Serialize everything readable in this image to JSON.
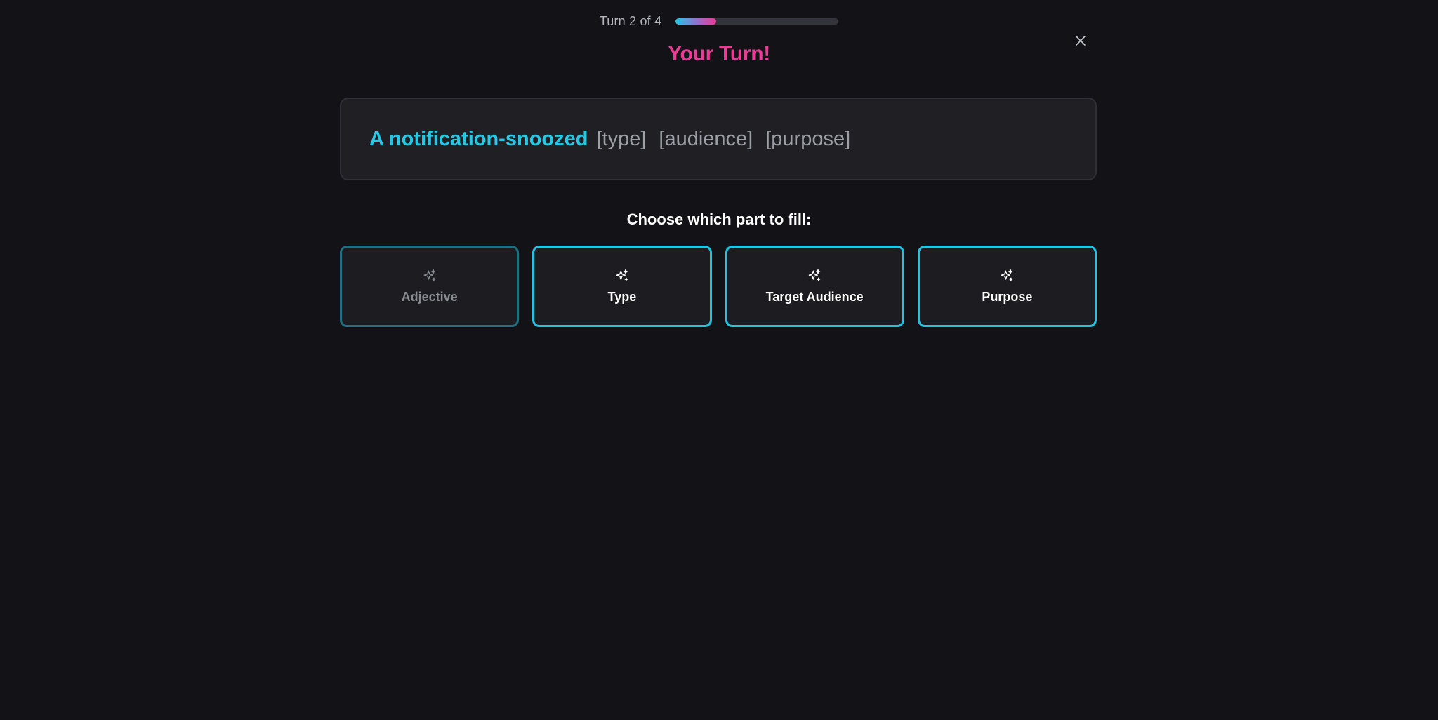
{
  "header": {
    "turn_label": "Turn 2 of 4",
    "progress_fraction": 0.25,
    "close_icon": "close-icon"
  },
  "title": "Your Turn!",
  "sentence": {
    "filled": "A notification-snoozed",
    "blanks": [
      "[type]",
      "[audience]",
      "[purpose]"
    ]
  },
  "prompt": "Choose which part to fill:",
  "options": [
    {
      "label": "Adjective",
      "icon": "sparkles-icon",
      "enabled": false
    },
    {
      "label": "Type",
      "icon": "sparkles-icon",
      "enabled": true
    },
    {
      "label": "Target Audience",
      "icon": "sparkles-icon",
      "enabled": true
    },
    {
      "label": "Purpose",
      "icon": "sparkles-icon",
      "enabled": true
    }
  ],
  "colors": {
    "accent_cyan": "#22c3e3",
    "accent_pink": "#ec3b96",
    "background": "#131317"
  }
}
